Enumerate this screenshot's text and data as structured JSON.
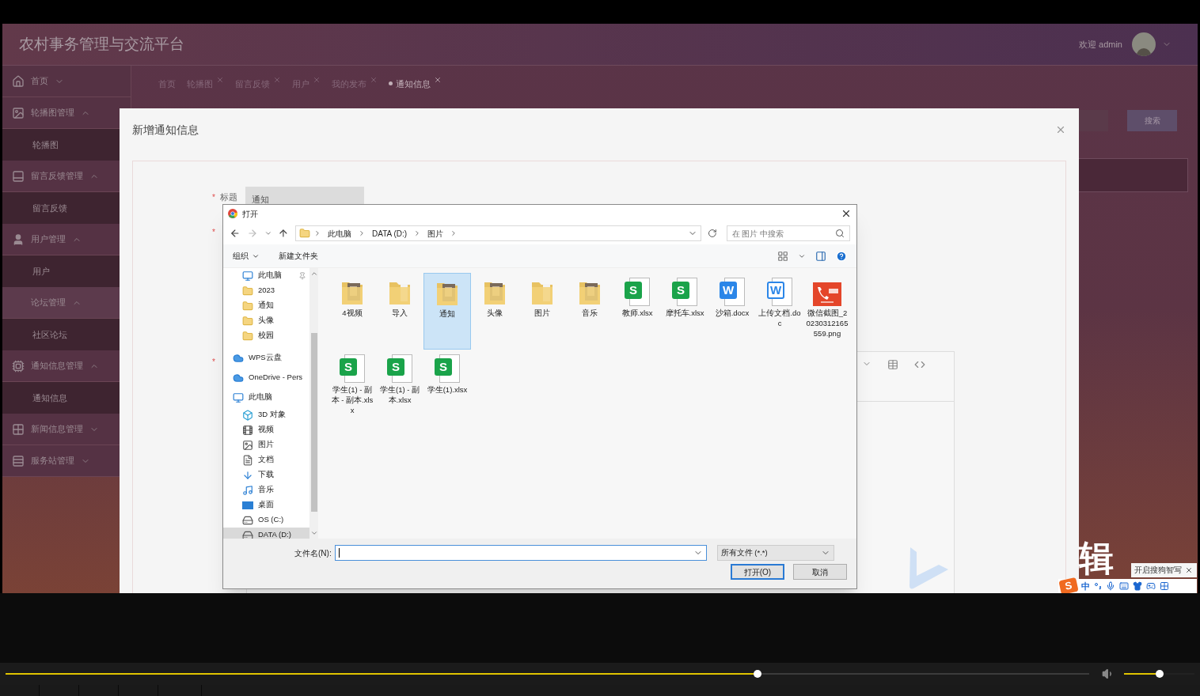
{
  "app": {
    "title": "农村事务管理与交流平台",
    "welcome": "欢迎 admin",
    "sidebar": [
      {
        "label": "首页",
        "kind": "home",
        "expanded": false
      },
      {
        "label": "轮播图管理",
        "kind": "carousel",
        "expanded": true,
        "children": [
          {
            "label": "轮播图"
          }
        ]
      },
      {
        "label": "留言反馈管理",
        "kind": "feedback",
        "expanded": true,
        "children": [
          {
            "label": "留言反馈"
          }
        ]
      },
      {
        "label": "用户管理",
        "kind": "user",
        "expanded": true,
        "children": [
          {
            "label": "用户"
          }
        ]
      },
      {
        "label": "论坛管理",
        "kind": "plain",
        "expanded": true,
        "children": [
          {
            "label": "社区论坛"
          }
        ]
      },
      {
        "label": "通知信息管理",
        "kind": "chip",
        "expanded": true,
        "children": [
          {
            "label": "通知信息"
          }
        ]
      },
      {
        "label": "新闻信息管理",
        "kind": "news",
        "expanded": false
      },
      {
        "label": "服务站管理",
        "kind": "list",
        "expanded": false
      }
    ],
    "tabs": [
      {
        "label": "首页",
        "closable": false,
        "selected": false
      },
      {
        "label": "轮播图",
        "closable": true,
        "selected": false
      },
      {
        "label": "留言反馈",
        "closable": true,
        "selected": false
      },
      {
        "label": "用户",
        "closable": true,
        "selected": false
      },
      {
        "label": "我的发布",
        "closable": true,
        "selected": false
      },
      {
        "label": "通知信息",
        "closable": true,
        "selected": true
      }
    ],
    "search_button": "搜索",
    "modal": {
      "title": "新增通知信息",
      "fields": [
        {
          "required_mark": "*",
          "label": "标题",
          "value": "通知"
        },
        {
          "required_mark": "*"
        },
        {
          "required_mark": "*"
        }
      ]
    }
  },
  "file_dialog": {
    "title": "打开",
    "path": [
      "此电脑",
      "DATA (D:)",
      "图片"
    ],
    "search_placeholder": "在 图片 中搜索",
    "toolbar": [
      {
        "label": "组织",
        "dropdown": true
      },
      {
        "label": "新建文件夹",
        "dropdown": false
      }
    ],
    "quick_access": [
      {
        "label": "此电脑",
        "kind": "pc",
        "pinned": true,
        "selected": false
      },
      {
        "label": "2023",
        "kind": "folder",
        "pinned": false,
        "selected": false
      },
      {
        "label": "通知",
        "kind": "folder",
        "pinned": false,
        "selected": false
      },
      {
        "label": "头像",
        "kind": "folder",
        "pinned": false,
        "selected": false
      },
      {
        "label": "校园",
        "kind": "folder",
        "pinned": false,
        "selected": false
      }
    ],
    "locations": [
      {
        "label": "WPS云盘",
        "kind": "cloud",
        "selected": false
      },
      {
        "label": "OneDrive - Pers",
        "kind": "cloud",
        "selected": false
      },
      {
        "label": "此电脑",
        "kind": "pc",
        "selected": false,
        "children": [
          {
            "label": "3D 对象",
            "kind": "cube",
            "selected": false
          },
          {
            "label": "视频",
            "kind": "video",
            "selected": false
          },
          {
            "label": "图片",
            "kind": "picture",
            "selected": false
          },
          {
            "label": "文档",
            "kind": "doc",
            "selected": false
          },
          {
            "label": "下载",
            "kind": "download",
            "selected": false
          },
          {
            "label": "音乐",
            "kind": "music",
            "selected": false
          },
          {
            "label": "桌面",
            "kind": "desktop",
            "selected": false
          },
          {
            "label": "OS (C:)",
            "kind": "drive",
            "selected": false
          },
          {
            "label": "DATA (D:)",
            "kind": "drive",
            "selected": true
          }
        ]
      }
    ],
    "files": [
      {
        "name": "4视频",
        "kind": "photo-folder",
        "selected": false
      },
      {
        "name": "导入",
        "kind": "folder",
        "selected": false
      },
      {
        "name": "通知",
        "kind": "photo-folder",
        "selected": true
      },
      {
        "name": "头像",
        "kind": "photo-folder",
        "selected": false
      },
      {
        "name": "图片",
        "kind": "folder",
        "selected": false
      },
      {
        "name": "音乐",
        "kind": "photo-folder",
        "selected": false
      },
      {
        "name": "教师.xlsx",
        "kind": "xlsx",
        "icon_letter": "S",
        "selected": false
      },
      {
        "name": "摩托车.xlsx",
        "kind": "xlsx",
        "icon_letter": "S",
        "selected": false
      },
      {
        "name": "沙箱.docx",
        "kind": "docx",
        "icon_letter": "W",
        "selected": false
      },
      {
        "name": "上传文档.doc",
        "kind": "doc",
        "icon_letter": "W",
        "selected": false
      },
      {
        "name": "微信截图_20230312165559.png",
        "kind": "image",
        "selected": false
      },
      {
        "name": "学生(1) - 副本 - 副本.xlsx",
        "kind": "xlsx",
        "icon_letter": "S",
        "selected": false
      },
      {
        "name": "学生(1) - 副本.xlsx",
        "kind": "xlsx",
        "icon_letter": "S",
        "selected": false
      },
      {
        "name": "学生(1).xlsx",
        "kind": "xlsx",
        "icon_letter": "S",
        "selected": false
      }
    ],
    "filename_label": "文件名(N):",
    "file_type": "所有文件 (*.*)",
    "buttons": [
      {
        "label": "打开(O)",
        "primary": true
      },
      {
        "label": "取消",
        "primary": false
      }
    ]
  },
  "ime": {
    "logo": "S",
    "mode": "中",
    "tooltip": "开启搜狗智写",
    "overlay_text": "辑"
  },
  "player": {
    "progress": {
      "level": 0.69
    },
    "volume": {
      "level": 0.45
    }
  }
}
